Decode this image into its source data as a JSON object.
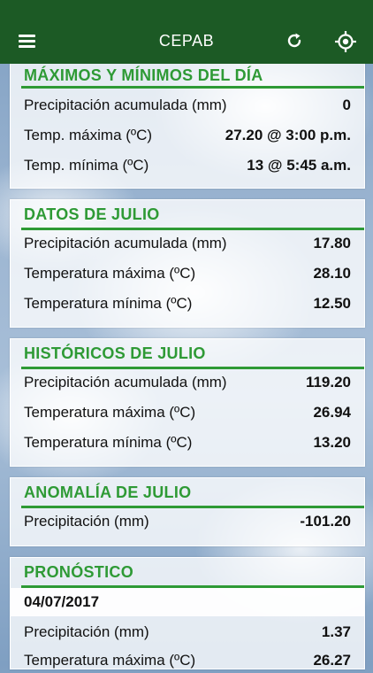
{
  "header": {
    "title": "CEPAB"
  },
  "today": {
    "title": "MÁXIMOS Y MÍNIMOS DEL DÍA",
    "rows": [
      {
        "label": "Precipitación acumulada (mm)",
        "value": "0"
      },
      {
        "label": "Temp. máxima (ºC)",
        "value": "27.20 @ 3:00 p.m."
      },
      {
        "label": "Temp. mínima (ºC)",
        "value": "13 @ 5:45 a.m."
      }
    ]
  },
  "month_data": {
    "title": "DATOS DE JULIO",
    "rows": [
      {
        "label": "Precipitación acumulada (mm)",
        "value": "17.80"
      },
      {
        "label": "Temperatura máxima (ºC)",
        "value": "28.10"
      },
      {
        "label": "Temperatura mínima (ºC)",
        "value": "12.50"
      }
    ]
  },
  "historical": {
    "title": "HISTÓRICOS DE JULIO",
    "rows": [
      {
        "label": "Precipitación acumulada (mm)",
        "value": "119.20"
      },
      {
        "label": "Temperatura máxima (ºC)",
        "value": "26.94"
      },
      {
        "label": "Temperatura mínima (ºC)",
        "value": "13.20"
      }
    ]
  },
  "anomaly": {
    "title": "ANOMALÍA DE JULIO",
    "rows": [
      {
        "label": "Precipitación (mm)",
        "value": "-101.20"
      }
    ]
  },
  "forecast": {
    "title": "PRONÓSTICO",
    "date": "04/07/2017",
    "rows": [
      {
        "label": "Precipitación (mm)",
        "value": "1.37"
      },
      {
        "label": "Temperatura máxima (ºC)",
        "value": "26.27"
      }
    ]
  },
  "colors": {
    "header_bg": "#1c5a25",
    "accent_green": "#2e9a35"
  },
  "icons": {
    "menu": "hamburger-icon",
    "refresh": "refresh-icon",
    "locate": "crosshair-icon"
  }
}
